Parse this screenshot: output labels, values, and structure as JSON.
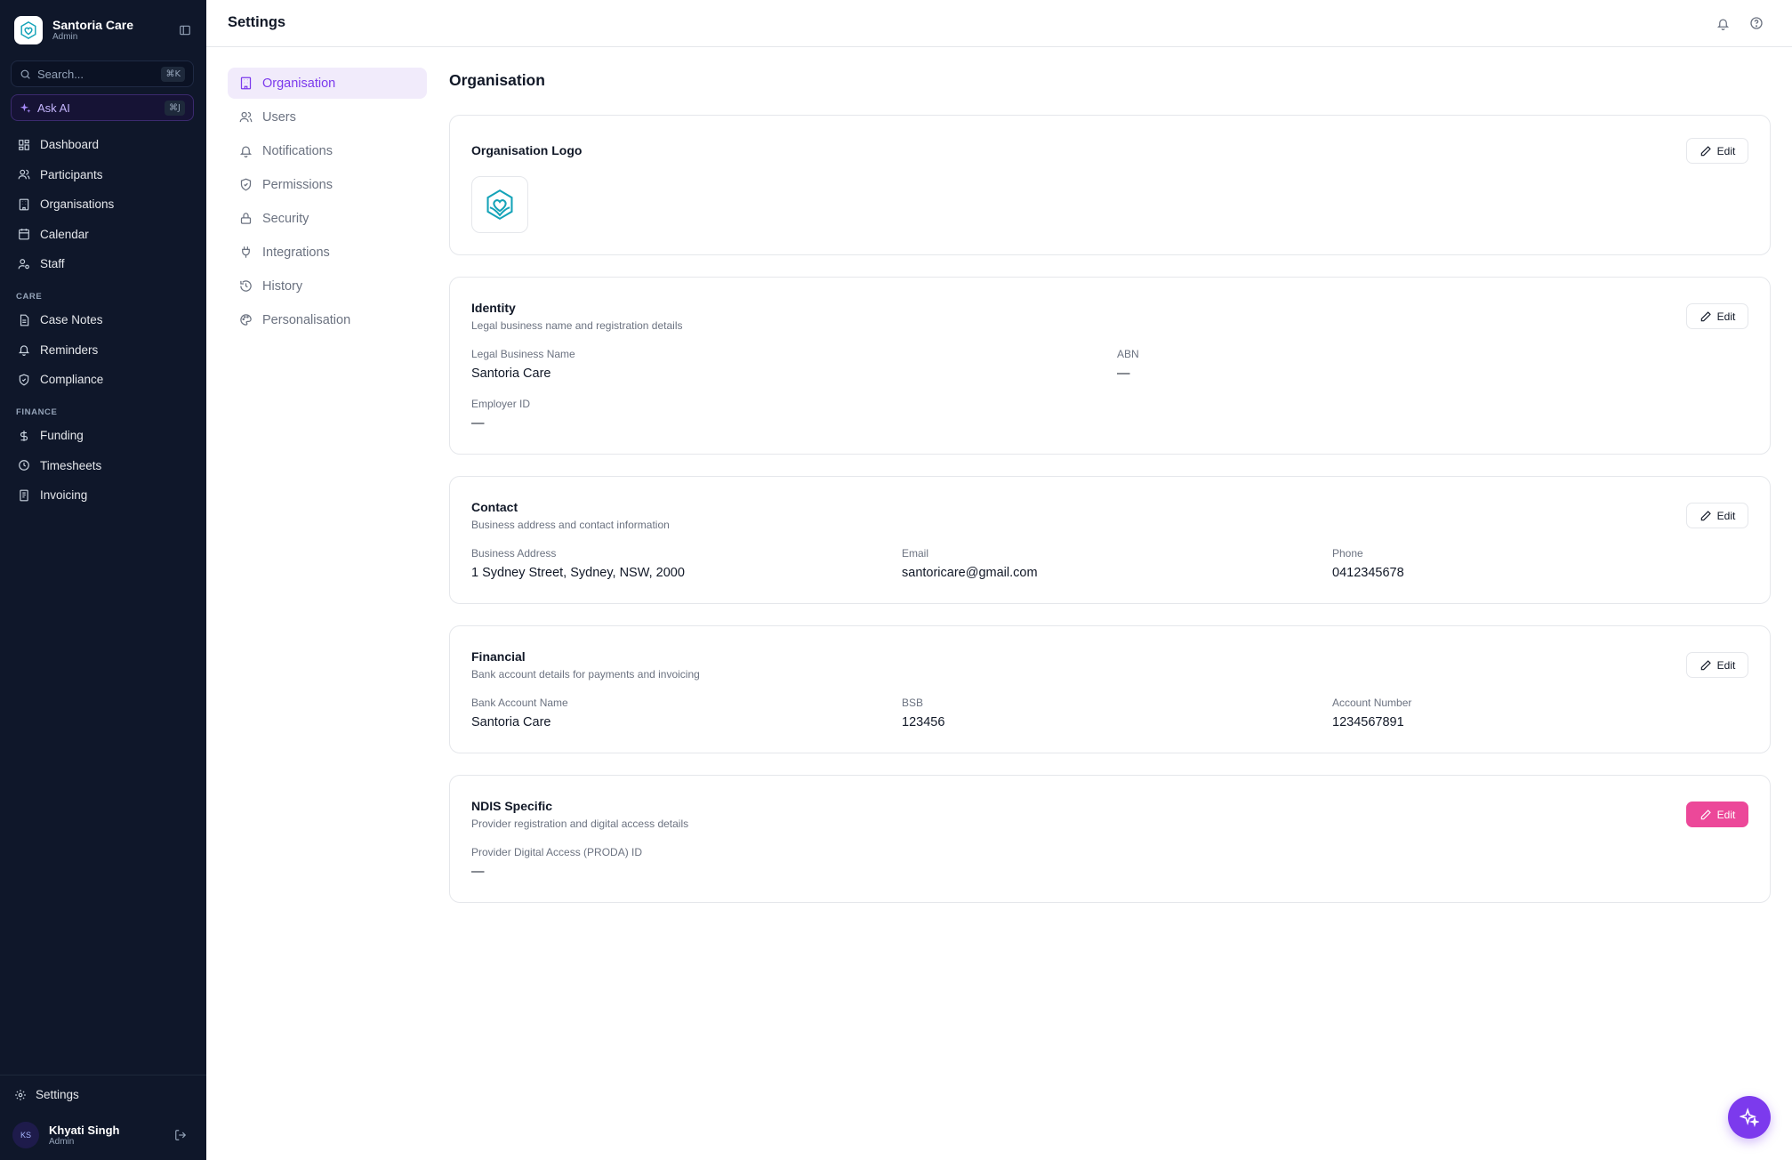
{
  "app": {
    "name": "Santoria Care",
    "role": "Admin"
  },
  "search": {
    "placeholder": "Search...",
    "shortcut": "⌘K"
  },
  "ask_ai": {
    "label": "Ask AI",
    "shortcut": "⌘J"
  },
  "sidebar": {
    "main": [
      {
        "label": "Dashboard",
        "icon": "dashboard-icon"
      },
      {
        "label": "Participants",
        "icon": "users-icon"
      },
      {
        "label": "Organisations",
        "icon": "building-icon"
      },
      {
        "label": "Calendar",
        "icon": "calendar-icon"
      },
      {
        "label": "Staff",
        "icon": "staff-icon"
      }
    ],
    "care_heading": "CARE",
    "care": [
      {
        "label": "Case Notes",
        "icon": "notes-icon"
      },
      {
        "label": "Reminders",
        "icon": "bell-icon"
      },
      {
        "label": "Compliance",
        "icon": "shield-icon"
      }
    ],
    "finance_heading": "FINANCE",
    "finance": [
      {
        "label": "Funding",
        "icon": "dollar-icon"
      },
      {
        "label": "Timesheets",
        "icon": "clock-icon"
      },
      {
        "label": "Invoicing",
        "icon": "invoice-icon"
      }
    ],
    "settings_label": "Settings"
  },
  "user": {
    "initials": "KS",
    "name": "Khyati Singh",
    "role": "Admin"
  },
  "topbar": {
    "title": "Settings"
  },
  "settings_nav": [
    {
      "label": "Organisation",
      "active": true
    },
    {
      "label": "Users"
    },
    {
      "label": "Notifications"
    },
    {
      "label": "Permissions"
    },
    {
      "label": "Security"
    },
    {
      "label": "Integrations"
    },
    {
      "label": "History"
    },
    {
      "label": "Personalisation"
    }
  ],
  "main": {
    "heading": "Organisation",
    "edit_label": "Edit",
    "logo_card": {
      "title": "Organisation Logo"
    },
    "identity": {
      "title": "Identity",
      "subtitle": "Legal business name and registration details",
      "legal_name_label": "Legal Business Name",
      "legal_name_value": "Santoria Care",
      "abn_label": "ABN",
      "abn_value": "—",
      "employer_id_label": "Employer ID",
      "employer_id_value": "—"
    },
    "contact": {
      "title": "Contact",
      "subtitle": "Business address and contact information",
      "address_label": "Business Address",
      "address_value": "1 Sydney Street, Sydney, NSW, 2000",
      "email_label": "Email",
      "email_value": "santoricare@gmail.com",
      "phone_label": "Phone",
      "phone_value": "0412345678"
    },
    "financial": {
      "title": "Financial",
      "subtitle": "Bank account details for payments and invoicing",
      "bank_name_label": "Bank Account Name",
      "bank_name_value": "Santoria Care",
      "bsb_label": "BSB",
      "bsb_value": "123456",
      "account_label": "Account Number",
      "account_value": "1234567891"
    },
    "ndis": {
      "title": "NDIS Specific",
      "subtitle": "Provider registration and digital access details",
      "proda_label": "Provider Digital Access (PRODA) ID",
      "proda_value": "—"
    }
  },
  "colors": {
    "sidebar_bg": "#0f172a",
    "accent": "#7c3aed",
    "edit_primary": "#ec4899",
    "logo_teal": "#14a3b8"
  }
}
